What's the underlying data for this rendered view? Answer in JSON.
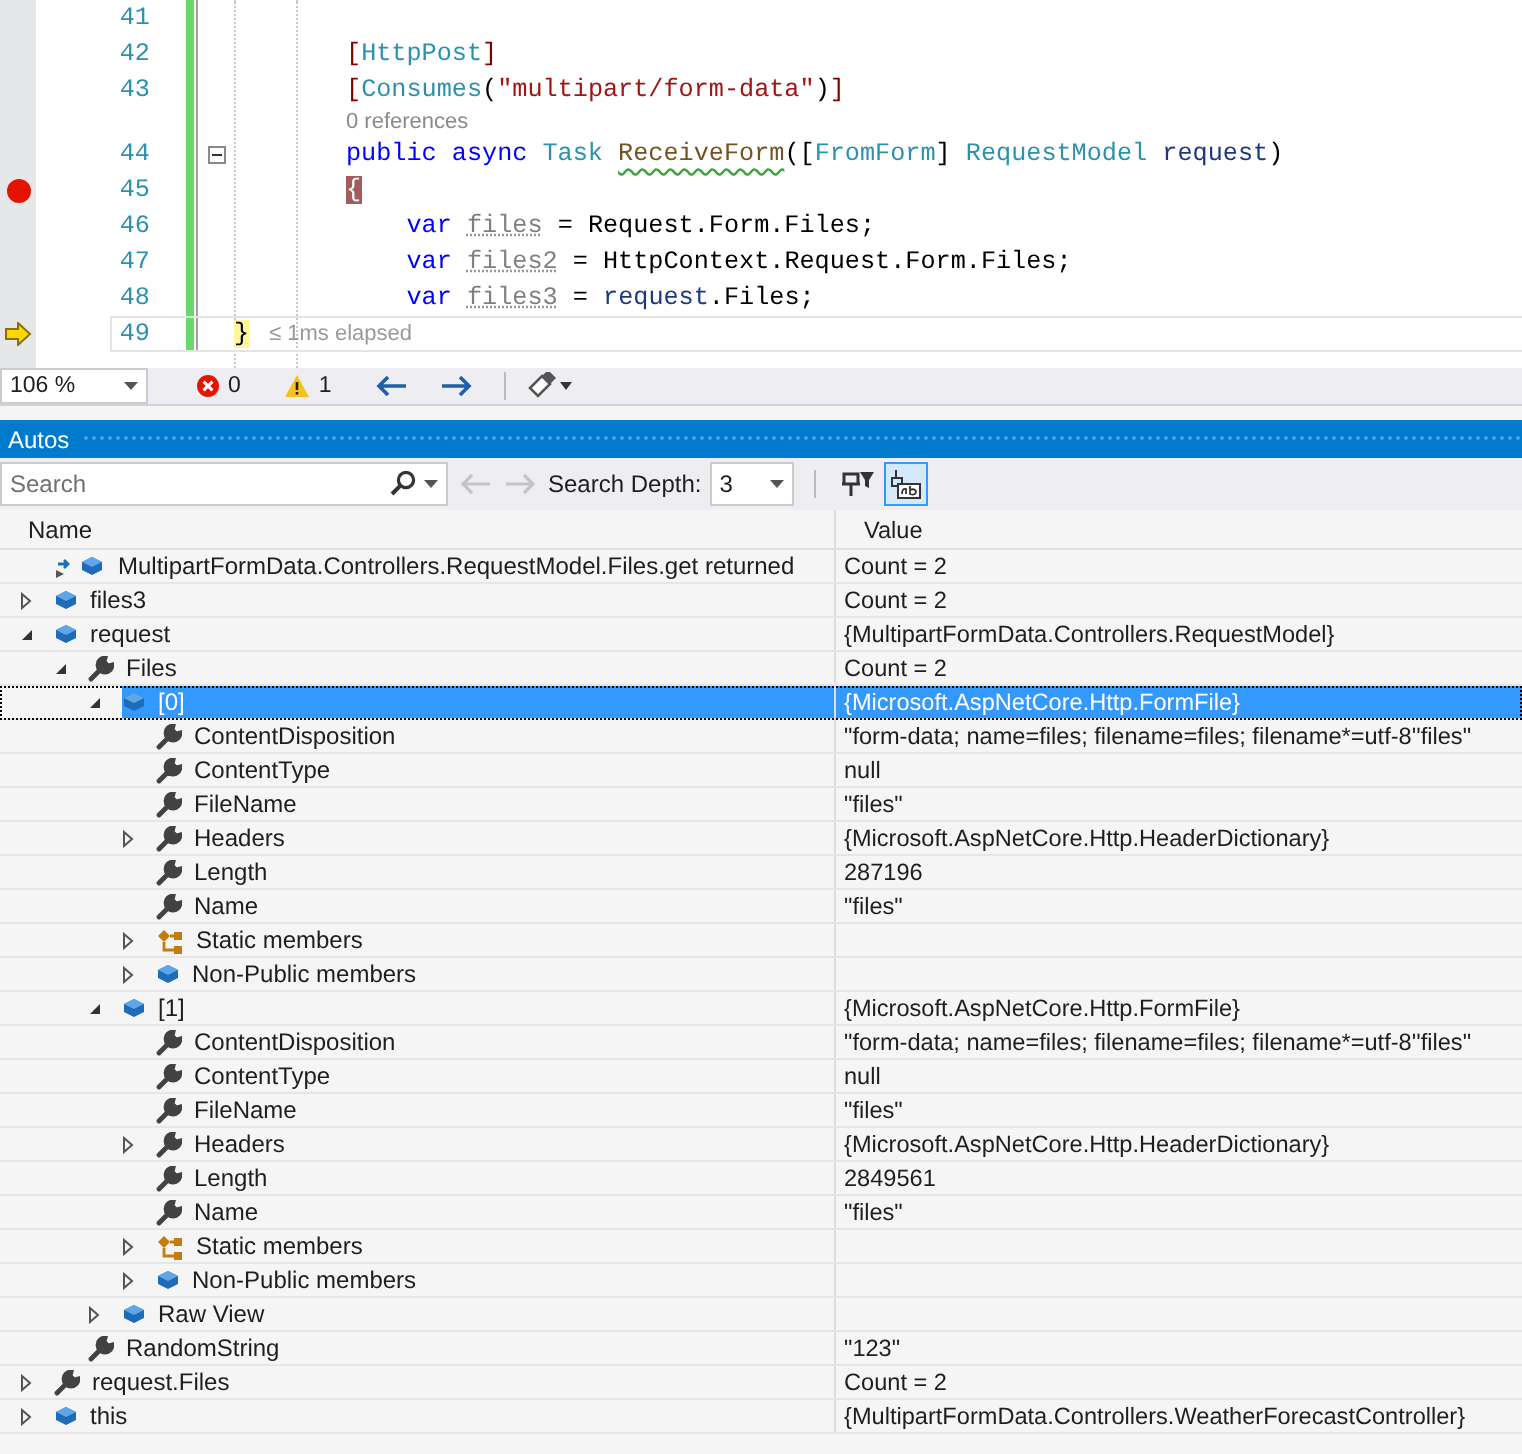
{
  "editor": {
    "lines": [
      {
        "kind": "code",
        "number": "41",
        "breakpoint": false,
        "current": false
      },
      {
        "kind": "code",
        "number": "42",
        "breakpoint": false,
        "current": false,
        "tokens": [
          {
            "text": "[",
            "kind": "attr_bracket"
          },
          {
            "text": "HttpPost",
            "kind": "type"
          },
          {
            "text": "]",
            "kind": "attr_bracket"
          }
        ]
      },
      {
        "kind": "code",
        "number": "43",
        "breakpoint": false,
        "current": false,
        "tokens": [
          {
            "text": "[",
            "kind": "attr_bracket"
          },
          {
            "text": "Consumes",
            "kind": "type"
          },
          {
            "text": "(",
            "kind": "plain"
          },
          {
            "text": "\"multipart/form-data\"",
            "kind": "string"
          },
          {
            "text": ")",
            "kind": "plain"
          },
          {
            "text": "]",
            "kind": "attr_bracket"
          }
        ]
      },
      {
        "kind": "lens",
        "text": "0 references"
      },
      {
        "kind": "code",
        "number": "44",
        "breakpoint": false,
        "current": false,
        "fold": {
          "expanded": true
        },
        "tokens": [
          {
            "text": "public async ",
            "kind": "keyword"
          },
          {
            "text": "Task ",
            "kind": "type"
          },
          {
            "text": "ReceiveForm",
            "kind": "method_warning"
          },
          {
            "text": "([",
            "kind": "plain"
          },
          {
            "text": "FromForm",
            "kind": "type"
          },
          {
            "text": "] ",
            "kind": "plain"
          },
          {
            "text": "RequestModel ",
            "kind": "type"
          },
          {
            "text": "request",
            "kind": "param"
          },
          {
            "text": ")",
            "kind": "plain"
          }
        ]
      },
      {
        "kind": "code",
        "number": "45",
        "breakpoint": true,
        "current": false,
        "tokens": [
          {
            "text": "{",
            "kind": "brace_breakpoint"
          }
        ]
      },
      {
        "kind": "code",
        "number": "46",
        "breakpoint": false,
        "current": false,
        "tokens": [
          {
            "text": "    var ",
            "kind": "keyword"
          },
          {
            "text": "files",
            "kind": "unused"
          },
          {
            "text": " = Request.Form.Files;",
            "kind": "plain"
          }
        ]
      },
      {
        "kind": "code",
        "number": "47",
        "breakpoint": false,
        "current": false,
        "tokens": [
          {
            "text": "    var ",
            "kind": "keyword"
          },
          {
            "text": "files2",
            "kind": "unused"
          },
          {
            "text": " = HttpContext.Request.Form.Files;",
            "kind": "plain"
          }
        ]
      },
      {
        "kind": "code",
        "number": "48",
        "breakpoint": false,
        "current": false,
        "tokens": [
          {
            "text": "    var ",
            "kind": "keyword"
          },
          {
            "text": "files3",
            "kind": "unused"
          },
          {
            "text": " = ",
            "kind": "plain"
          },
          {
            "text": "request",
            "kind": "param"
          },
          {
            "text": ".Files;",
            "kind": "plain"
          }
        ]
      },
      {
        "kind": "code",
        "number": "49",
        "breakpoint": false,
        "current": true,
        "hint": "≤ 1ms elapsed",
        "tokens": [
          {
            "text": "}",
            "kind": "brace_current"
          }
        ]
      }
    ]
  },
  "editor_status": {
    "zoom": "106 %",
    "errors": "0",
    "warnings": "1"
  },
  "autos": {
    "title": "Autos",
    "search": {
      "placeholder": "Search"
    },
    "history": {
      "back_disabled": true,
      "forward_disabled": true
    },
    "depth": {
      "label": "Search Depth:",
      "value": "3"
    },
    "toggles": [
      {
        "kind": "pin",
        "selected": false
      },
      {
        "kind": "raw",
        "selected": true
      }
    ],
    "columns": [
      "Name",
      "Value"
    ],
    "rows": [
      {
        "name": "MultipartFormData.Controllers.RequestModel.Files.get returned",
        "value": "Count = 2",
        "kind": "return",
        "selected": false
      },
      {
        "name": "files3",
        "value": "Count = 2",
        "kind": "object",
        "expanded": false,
        "selected": false
      },
      {
        "name": "request",
        "value": "{MultipartFormData.Controllers.RequestModel}",
        "kind": "object",
        "expanded": true,
        "selected": false,
        "children": [
          {
            "name": "Files",
            "value": "Count = 2",
            "kind": "property",
            "expanded": true,
            "selected": false,
            "children": [
              {
                "name": "[0]",
                "value": "{Microsoft.AspNetCore.Http.FormFile}",
                "kind": "object",
                "expanded": true,
                "selected": true,
                "children": [
                  {
                    "name": "ContentDisposition",
                    "value": "\"form-data; name=files; filename=files; filename*=utf-8''files\"",
                    "kind": "property",
                    "selected": false
                  },
                  {
                    "name": "ContentType",
                    "value": "null",
                    "kind": "property",
                    "selected": false
                  },
                  {
                    "name": "FileName",
                    "value": "\"files\"",
                    "kind": "property",
                    "selected": false
                  },
                  {
                    "name": "Headers",
                    "value": "{Microsoft.AspNetCore.Http.HeaderDictionary}",
                    "kind": "property",
                    "expanded": false,
                    "selected": false
                  },
                  {
                    "name": "Length",
                    "value": "287196",
                    "kind": "property",
                    "selected": false
                  },
                  {
                    "name": "Name",
                    "value": "\"files\"",
                    "kind": "property",
                    "selected": false
                  },
                  {
                    "name": "Static members",
                    "kind": "static",
                    "expanded": false,
                    "selected": false
                  },
                  {
                    "name": "Non-Public members",
                    "kind": "object",
                    "expanded": false,
                    "selected": false
                  }
                ]
              },
              {
                "name": "[1]",
                "value": "{Microsoft.AspNetCore.Http.FormFile}",
                "kind": "object",
                "expanded": true,
                "selected": false,
                "children": [
                  {
                    "name": "ContentDisposition",
                    "value": "\"form-data; name=files; filename=files; filename*=utf-8''files\"",
                    "kind": "property",
                    "selected": false
                  },
                  {
                    "name": "ContentType",
                    "value": "null",
                    "kind": "property",
                    "selected": false
                  },
                  {
                    "name": "FileName",
                    "value": "\"files\"",
                    "kind": "property",
                    "selected": false
                  },
                  {
                    "name": "Headers",
                    "value": "{Microsoft.AspNetCore.Http.HeaderDictionary}",
                    "kind": "property",
                    "expanded": false,
                    "selected": false
                  },
                  {
                    "name": "Length",
                    "value": "2849561",
                    "kind": "property",
                    "selected": false
                  },
                  {
                    "name": "Name",
                    "value": "\"files\"",
                    "kind": "property",
                    "selected": false
                  },
                  {
                    "name": "Static members",
                    "kind": "static",
                    "expanded": false,
                    "selected": false
                  },
                  {
                    "name": "Non-Public members",
                    "kind": "object",
                    "expanded": false,
                    "selected": false
                  }
                ]
              },
              {
                "name": "Raw View",
                "kind": "object",
                "expanded": false,
                "selected": false
              }
            ]
          },
          {
            "name": "RandomString",
            "value": "\"123\"",
            "kind": "property",
            "selected": false
          }
        ]
      },
      {
        "name": "request.Files",
        "value": "Count = 2",
        "kind": "property",
        "expanded": false,
        "selected": false
      },
      {
        "name": "this",
        "value": "{MultipartFormData.Controllers.WeatherForecastController}",
        "kind": "object",
        "expanded": false,
        "selected": false
      }
    ]
  }
}
